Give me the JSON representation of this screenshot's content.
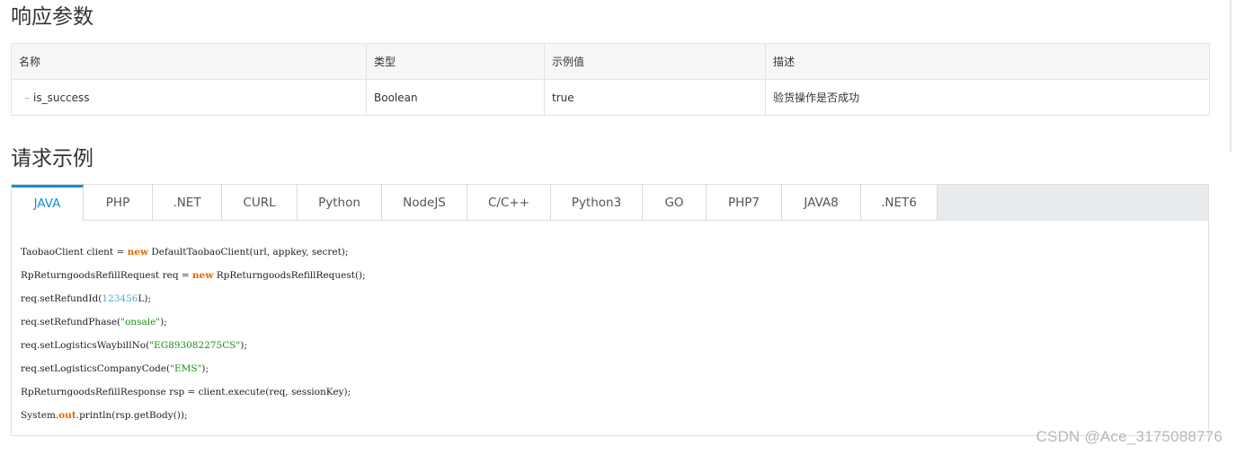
{
  "response_section": {
    "title": "响应参数",
    "columns": [
      "名称",
      "类型",
      "示例值",
      "描述"
    ],
    "rows": [
      {
        "name": "is_success",
        "type": "Boolean",
        "example": "true",
        "description": "验货操作是否成功"
      }
    ]
  },
  "request_section": {
    "title": "请求示例",
    "tabs": [
      "JAVA",
      "PHP",
      ".NET",
      "CURL",
      "Python",
      "NodeJS",
      "C/C++",
      "Python3",
      "GO",
      "PHP7",
      "JAVA8",
      ".NET6"
    ],
    "active_tab": "JAVA",
    "code": {
      "line1": {
        "a": "TaobaoClient client = ",
        "kw": "new",
        "b": " DefaultTaobaoClient(url, appkey, secret);"
      },
      "line2": {
        "a": "RpReturngoodsRefillRequest req = ",
        "kw": "new",
        "b": " RpReturngoodsRefillRequest();"
      },
      "line3": {
        "a": "req.setRefundId(",
        "num": "123456",
        "b": "L);"
      },
      "line4": {
        "a": "req.setRefundPhase(",
        "str": "\"onsale\"",
        "b": ");"
      },
      "line5": {
        "a": "req.setLogisticsWaybillNo(",
        "str": "\"EG893082275CS\"",
        "b": ");"
      },
      "line6": {
        "a": "req.setLogisticsCompanyCode(",
        "str": "\"EMS\"",
        "b": ");"
      },
      "line7": {
        "a": "RpReturngoodsRefillResponse rsp = client.execute(req, sessionKey);"
      },
      "line8": {
        "a": "System.",
        "kw": "out",
        "b": ".println(rsp.getBody());"
      }
    }
  },
  "watermark": "CSDN @Ace_3175088776",
  "colors": {
    "accent": "#1a8bd8",
    "keyword": "#e06800",
    "number": "#4aa8d8",
    "string": "#1b8f1b"
  }
}
